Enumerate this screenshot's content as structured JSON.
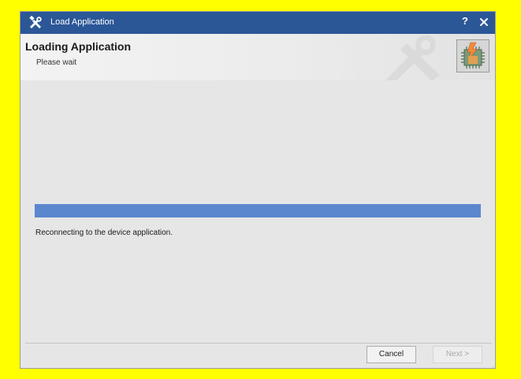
{
  "window": {
    "title": "Load Application",
    "help_label": "?",
    "close_icon": "close-icon",
    "app_icon": "tools-icon"
  },
  "header": {
    "heading": "Loading Application",
    "subheading": "Please wait",
    "logo_icon": "chip-logo-icon",
    "watermark_icon": "tools-watermark-icon"
  },
  "progress": {
    "value_percent": 100,
    "status_text": "Reconnecting to the device application."
  },
  "buttons": {
    "cancel_label": "Cancel",
    "next_label": "Next >",
    "next_enabled": false
  },
  "colors": {
    "titlebar": "#2b5797",
    "progress_fill": "#5b87cf",
    "page_background": "#ffff00",
    "window_background": "#e6e6e6"
  }
}
